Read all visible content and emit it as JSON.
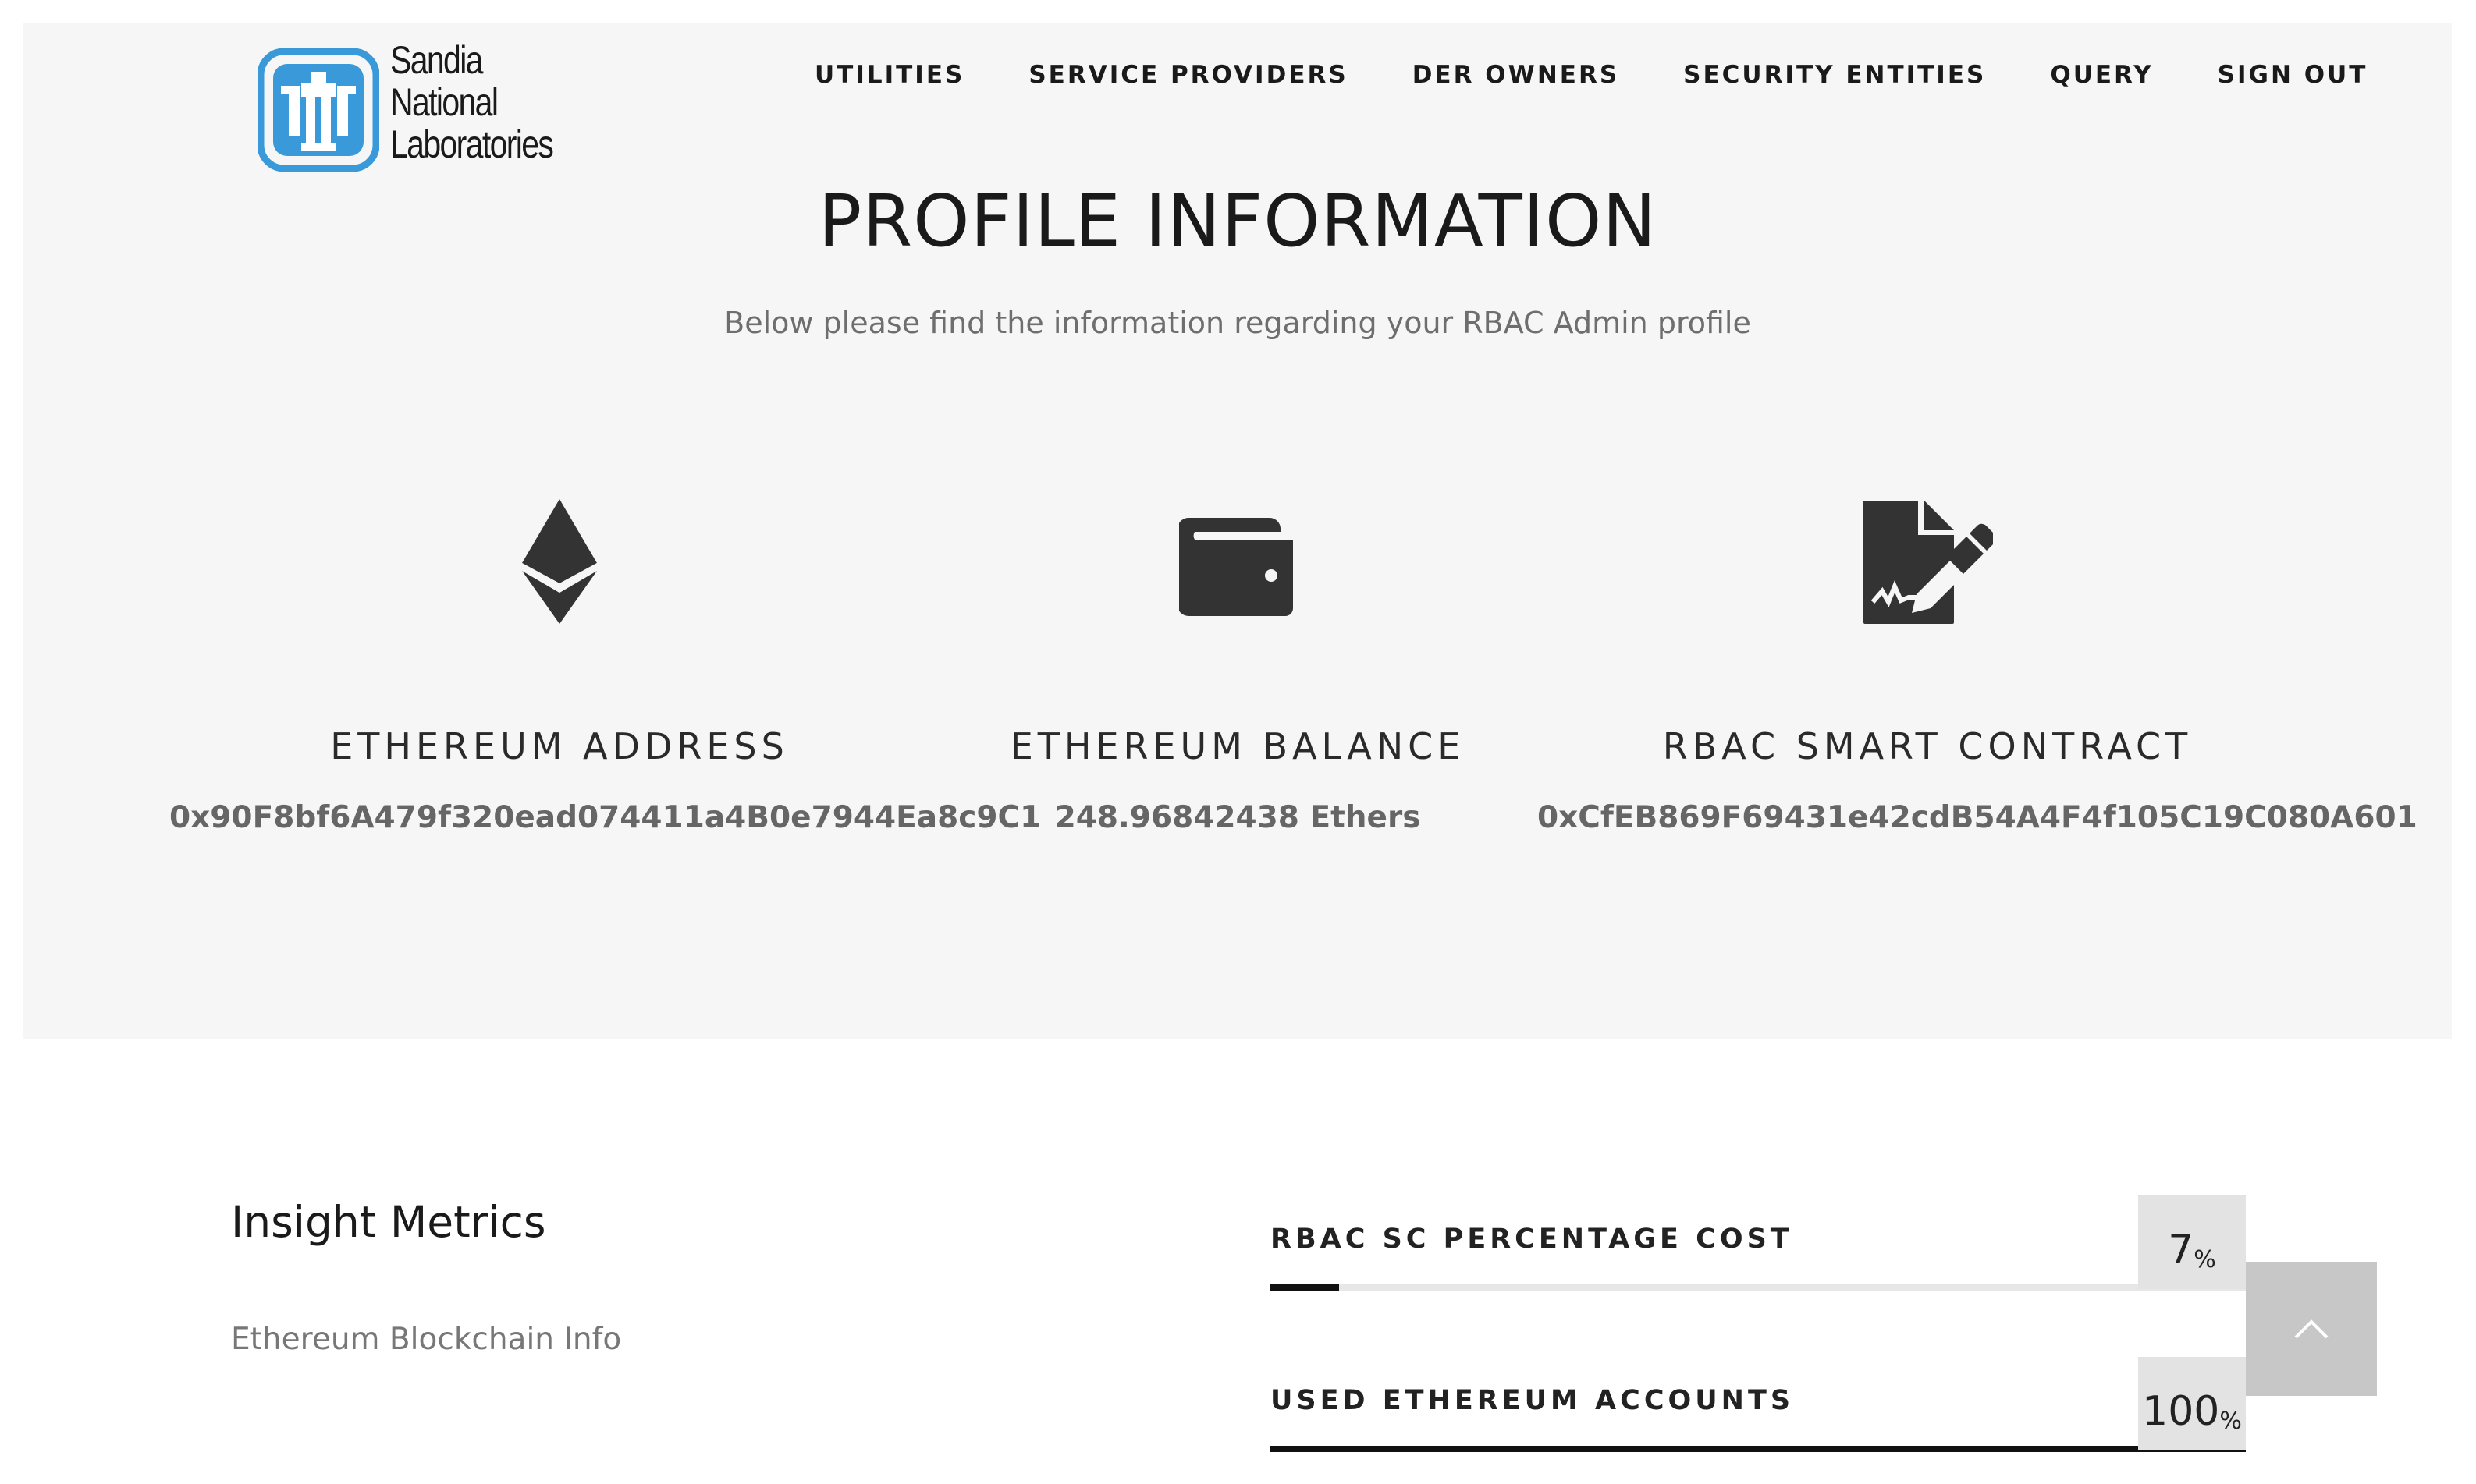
{
  "logo": {
    "lines": [
      "Sandia",
      "National",
      "Laboratories"
    ],
    "brand_color": "#3a9ad9"
  },
  "nav": {
    "items": [
      "UTILITIES",
      "SERVICE PROVIDERS",
      "DER OWNERS",
      "SECURITY ENTITIES",
      "QUERY",
      "SIGN OUT"
    ]
  },
  "header": {
    "title": "PROFILE INFORMATION",
    "subtitle": "Below please find the information regarding your RBAC Admin profile"
  },
  "profile": {
    "columns": [
      {
        "icon": "ethereum-icon",
        "label": "ETHEREUM ADDRESS",
        "value": "0x90F8bf6A479f320ead074411a4B0e7944Ea8c9C1"
      },
      {
        "icon": "wallet-icon",
        "label": "ETHEREUM BALANCE",
        "value": "248.96842438 Ethers"
      },
      {
        "icon": "contract-sign-icon",
        "label": "RBAC SMART CONTRACT",
        "value": "0xCfEB869F69431e42cdB54A4F4f105C19C080A601"
      }
    ]
  },
  "insight": {
    "title": "Insight Metrics",
    "subtitle": "Ethereum Blockchain Info"
  },
  "metrics": [
    {
      "label": "RBAC SC PERCENTAGE COST",
      "value": "7",
      "unit": "%",
      "fill_percent": 7
    },
    {
      "label": "USED ETHEREUM ACCOUNTS",
      "value": "100",
      "unit": "%",
      "fill_percent": 100
    }
  ],
  "colors": {
    "hero_bg": "#f6f6f6",
    "accent": "#111111",
    "scroll_button_bg": "#c7c7c7"
  },
  "scroll_top": {
    "icon": "chevron-up-icon"
  }
}
